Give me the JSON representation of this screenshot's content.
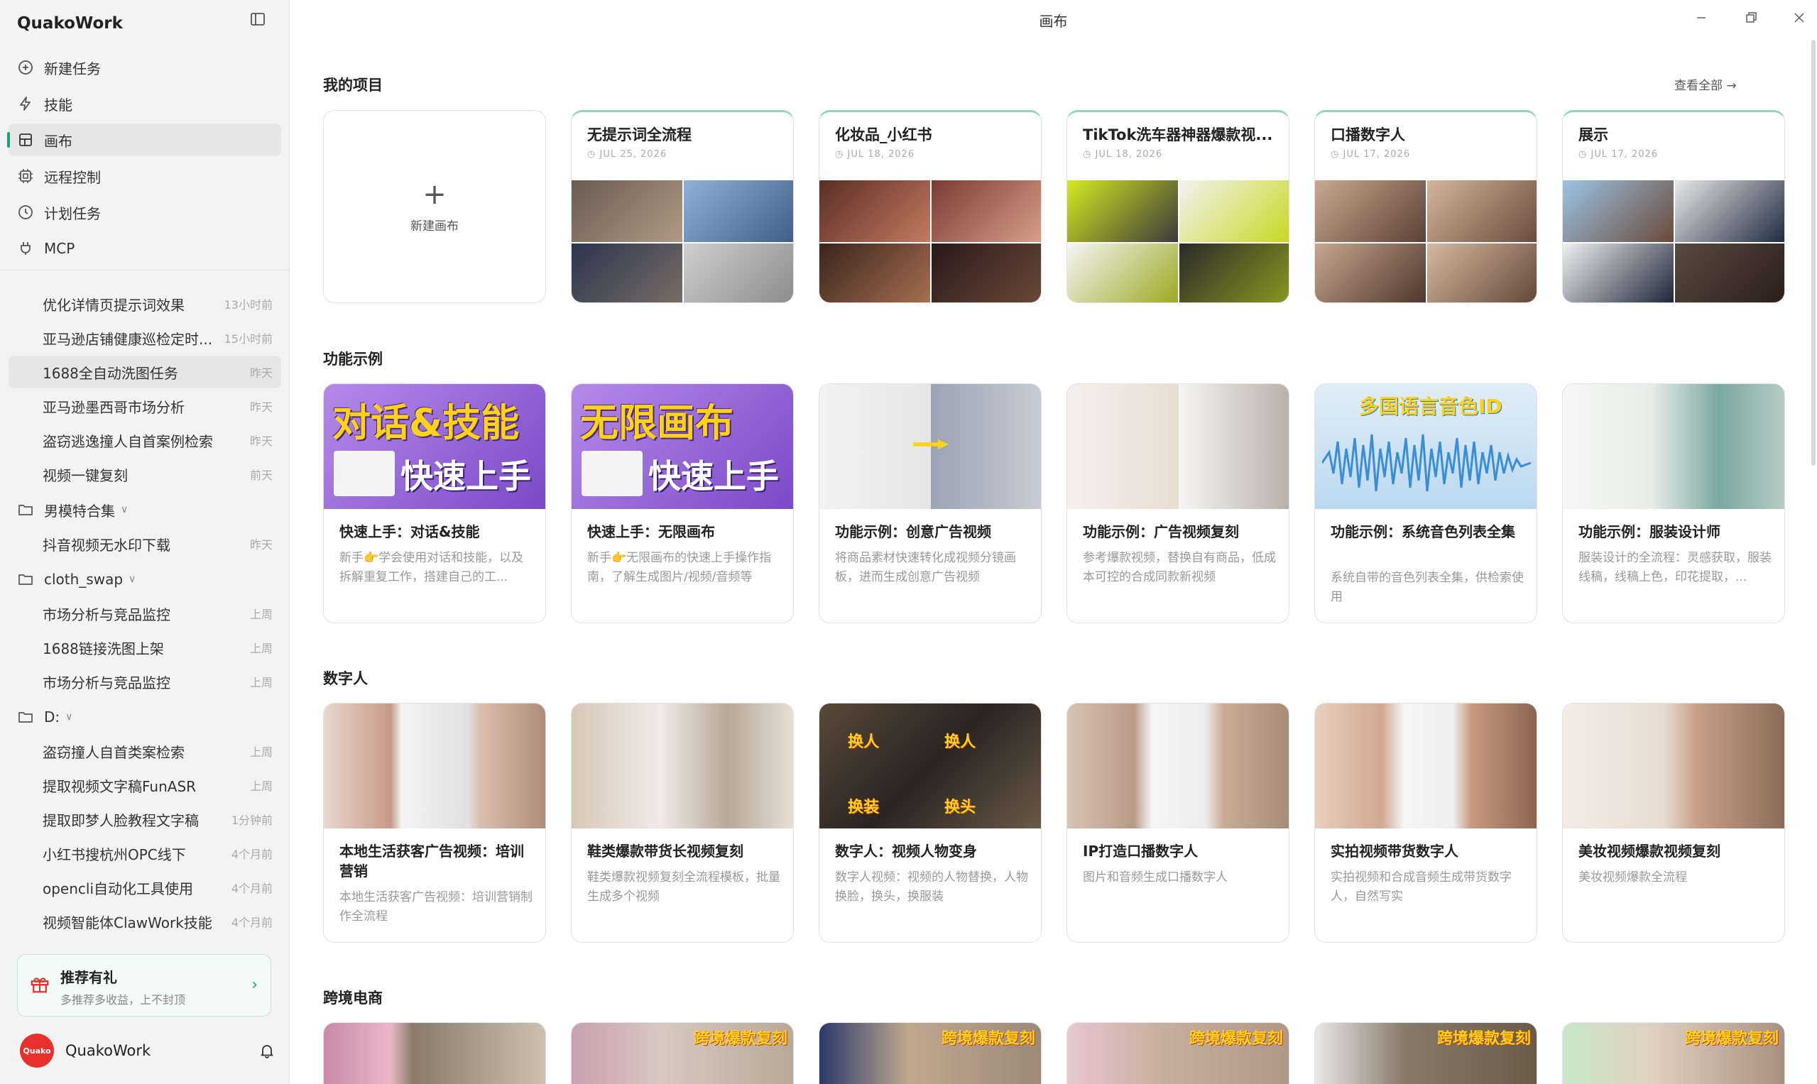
{
  "app": {
    "name": "QuakoWork",
    "window_title": "画布"
  },
  "nav": [
    {
      "label": "新建任务",
      "icon": "plus-circle-icon"
    },
    {
      "label": "技能",
      "icon": "lightning-icon"
    },
    {
      "label": "画布",
      "icon": "canvas-icon",
      "active": true
    },
    {
      "label": "远程控制",
      "icon": "remote-icon"
    },
    {
      "label": "计划任务",
      "icon": "clock-icon"
    },
    {
      "label": "MCP",
      "icon": "plug-icon"
    }
  ],
  "history": {
    "recent": [
      {
        "title": "优化详情页提示词效果",
        "time": "13小时前"
      },
      {
        "title": "亚马逊店铺健康巡检定时...",
        "time": "15小时前"
      },
      {
        "title": "1688全自动洗图任务",
        "time": "昨天"
      },
      {
        "title": "亚马逊墨西哥市场分析",
        "time": "昨天"
      },
      {
        "title": "盗窃逃逸撞人自首案例检索",
        "time": "昨天"
      },
      {
        "title": "视频一键复刻",
        "time": "前天"
      }
    ],
    "groups": [
      {
        "name": "男模特合集",
        "items": [
          {
            "title": "抖音视频无水印下载",
            "time": "昨天"
          }
        ]
      },
      {
        "name": "cloth_swap",
        "items": [
          {
            "title": "市场分析与竞品监控",
            "time": "上周"
          },
          {
            "title": "1688链接洗图上架",
            "time": "上周"
          },
          {
            "title": "市场分析与竞品监控",
            "time": "上周"
          }
        ]
      },
      {
        "name": "D:",
        "items": [
          {
            "title": "盗窃撞人自首类案检索",
            "time": "上周"
          },
          {
            "title": "提取视频文字稿FunASR",
            "time": "上周"
          },
          {
            "title": "提取即梦人脸教程文字稿",
            "time": "1分钟前"
          },
          {
            "title": "小红书搜杭州OPC线下",
            "time": "4个月前"
          },
          {
            "title": "opencli自动化工具使用",
            "time": "4个月前"
          },
          {
            "title": "视频智能体ClawWork技能",
            "time": "4个月前"
          }
        ]
      }
    ]
  },
  "promo": {
    "title": "推荐有礼",
    "subtitle": "多推荐多收益，上不封顶"
  },
  "user": {
    "name": "QuakoWork",
    "avatar_text": "Quako"
  },
  "sections": {
    "projects": {
      "title": "我的项目",
      "see_all": "查看全部",
      "new_label": "新建画布",
      "items": [
        {
          "title": "无提示词全流程",
          "date": "JUL 25, 2026"
        },
        {
          "title": "化妆品_小红书",
          "date": "JUL 18, 2026"
        },
        {
          "title": "TikTok洗车器神器爆款视...",
          "date": "JUL 18, 2026"
        },
        {
          "title": "口播数字人",
          "date": "JUL 17, 2026"
        },
        {
          "title": "展示",
          "date": "JUL 17, 2026"
        }
      ]
    },
    "features": {
      "title": "功能示例",
      "items": [
        {
          "title": "快速上手：对话&技能",
          "desc": "新手👉学会使用对话和技能，以及拆解重复工作，搭建自己的工...",
          "banner1": "对话&技能",
          "banner2": "快速上手"
        },
        {
          "title": "快速上手：无限画布",
          "desc": "新手👉无限画布的快速上手操作指南，了解生成图片/视频/音频等",
          "banner1": "无限画布",
          "banner2": "快速上手"
        },
        {
          "title": "功能示例：创意广告视频",
          "desc": "将商品素材快速转化成视频分镜画板，进而生成创意广告视频"
        },
        {
          "title": "功能示例：广告视频复刻",
          "desc": "参考爆款视频，替换自有商品，低成本可控的合成同款新视频"
        },
        {
          "title": "功能示例：系统音色列表全集",
          "desc": "系统自带的音色列表全集，供检索使用",
          "banner1": "多国语言音色ID"
        },
        {
          "title": "功能示例：服装设计师",
          "desc": "服装设计的全流程：灵感获取，服装线稿，线稿上色，印花提取，..."
        }
      ]
    },
    "digital_human": {
      "title": "数字人",
      "items": [
        {
          "title": "本地生活获客广告视频：培训营销",
          "desc": "本地生活获客广告视频：培训营销制作全流程"
        },
        {
          "title": "鞋类爆款带货长视频复刻",
          "desc": "鞋类爆款视频复刻全流程模板，批量生成多个视频"
        },
        {
          "title": "数字人：视频人物变身",
          "desc": "数字人视频：视频的人物替换，人物换脸，换头，换服装",
          "tags": [
            "换人",
            "换人",
            "换装",
            "换头"
          ]
        },
        {
          "title": "IP打造口播数字人",
          "desc": "图片和音频生成口播数字人"
        },
        {
          "title": "实拍视频带货数字人",
          "desc": "实拍视频和合成音频生成带货数字人，自然写实"
        },
        {
          "title": "美妆视频爆款视频复刻",
          "desc": "美妆视频爆款全流程"
        }
      ]
    },
    "crossborder": {
      "title": "跨境电商",
      "tag": "跨境爆款复刻"
    }
  },
  "colors": {
    "accent": "#1aa37a",
    "banner_purple": "#8a5ad0",
    "banner_yellow": "#ffd21a"
  }
}
